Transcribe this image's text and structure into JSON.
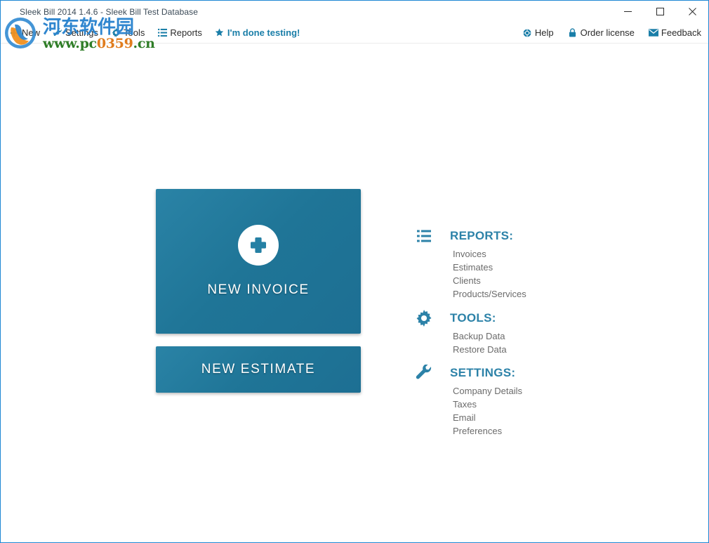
{
  "window": {
    "title": "Sleek Bill 2014 1.4.6 - Sleek Bill Test Database",
    "controls": {
      "minimize": "minimize",
      "maximize": "maximize",
      "close": "close"
    },
    "border_color": "#1e87d4"
  },
  "toolbar": {
    "left_items": [
      {
        "label": "New",
        "icon": "plus-icon"
      },
      {
        "label": "Settings",
        "icon": "wrench-icon"
      },
      {
        "label": "Tools",
        "icon": "gear-icon"
      },
      {
        "label": "Reports",
        "icon": "list-icon"
      },
      {
        "label": "I'm done testing!",
        "icon": "star-icon",
        "accent": true
      }
    ],
    "right_items": [
      {
        "label": "Help",
        "icon": "help-icon"
      },
      {
        "label": "Order license",
        "icon": "lock-icon"
      },
      {
        "label": "Feedback",
        "icon": "envelope-icon"
      }
    ]
  },
  "main": {
    "tiles": [
      {
        "label": "NEW INVOICE",
        "icon": "plus-circle-icon"
      },
      {
        "label": "NEW ESTIMATE"
      }
    ],
    "sections": [
      {
        "title": "REPORTS:",
        "icon": "list-icon",
        "links": [
          "Invoices",
          "Estimates",
          "Clients",
          "Products/Services"
        ]
      },
      {
        "title": "TOOLS:",
        "icon": "gear-icon",
        "links": [
          "Backup Data",
          "Restore Data"
        ]
      },
      {
        "title": "SETTINGS:",
        "icon": "wrench-icon",
        "links": [
          "Company Details",
          "Taxes",
          "Email",
          "Preferences"
        ]
      }
    ]
  },
  "watermark": {
    "site_name": "河东软件园",
    "url_prefix": "www.pc",
    "url_digits": "0359",
    "url_suffix": ".cn",
    "name_color": "#2f86cf",
    "url_color": "#2f7d27"
  },
  "colors": {
    "accent_blue": "#2c82a8",
    "tile_blue": "#1f7597",
    "link_gray": "#6b6b6b",
    "title_blue": "#1e87d4"
  }
}
